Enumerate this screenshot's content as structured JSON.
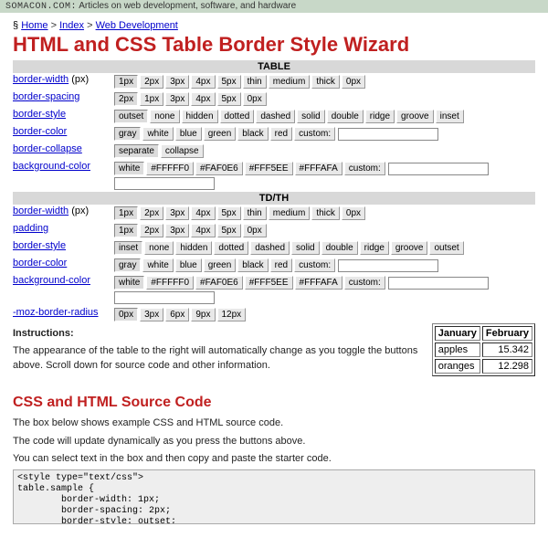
{
  "topbar": {
    "brand": "SOMACON.COM:",
    "tagline": "Articles on web development, software, and hardware"
  },
  "breadcrumb": {
    "prefix": "§",
    "home": "Home",
    "index": "Index",
    "wd": "Web Development",
    "sep": ">"
  },
  "title": "HTML and CSS Table Border Style Wizard",
  "groups": {
    "table": {
      "header": "TABLE",
      "rows": {
        "border_width": {
          "label": "border-width",
          "suffix": "(px)",
          "opts": [
            "1px",
            "2px",
            "3px",
            "4px",
            "5px",
            "thin",
            "medium",
            "thick",
            "0px"
          ],
          "sel": 0
        },
        "border_spacing": {
          "label": "border-spacing",
          "opts": [
            "2px",
            "1px",
            "3px",
            "4px",
            "5px",
            "0px"
          ],
          "sel": 0
        },
        "border_style": {
          "label": "border-style",
          "opts": [
            "outset",
            "none",
            "hidden",
            "dotted",
            "dashed",
            "solid",
            "double",
            "ridge",
            "groove",
            "inset"
          ],
          "sel": 0
        },
        "border_color": {
          "label": "border-color",
          "opts": [
            "gray",
            "white",
            "blue",
            "green",
            "black",
            "red",
            "custom:"
          ],
          "sel": 0,
          "custom": ""
        },
        "border_collapse": {
          "label": "border-collapse",
          "opts": [
            "separate",
            "collapse"
          ],
          "sel": 0
        },
        "background_color": {
          "label": "background-color",
          "opts": [
            "white",
            "#FFFFF0",
            "#FAF0E6",
            "#FFF5EE",
            "#FFFAFA",
            "custom:"
          ],
          "sel": 0,
          "custom": ""
        }
      }
    },
    "tdth": {
      "header": "TD/TH",
      "rows": {
        "border_width": {
          "label": "border-width",
          "suffix": "(px)",
          "opts": [
            "1px",
            "2px",
            "3px",
            "4px",
            "5px",
            "thin",
            "medium",
            "thick",
            "0px"
          ],
          "sel": 0
        },
        "padding": {
          "label": "padding",
          "opts": [
            "1px",
            "2px",
            "3px",
            "4px",
            "5px",
            "0px"
          ],
          "sel": 0
        },
        "border_style": {
          "label": "border-style",
          "opts": [
            "inset",
            "none",
            "hidden",
            "dotted",
            "dashed",
            "solid",
            "double",
            "ridge",
            "groove",
            "outset"
          ],
          "sel": 0
        },
        "border_color": {
          "label": "border-color",
          "opts": [
            "gray",
            "white",
            "blue",
            "green",
            "black",
            "red",
            "custom:"
          ],
          "sel": 0,
          "custom": ""
        },
        "background_color": {
          "label": "background-color",
          "opts": [
            "white",
            "#FFFFF0",
            "#FAF0E6",
            "#FFF5EE",
            "#FFFAFA",
            "custom:"
          ],
          "sel": 0,
          "custom": ""
        },
        "moz_radius": {
          "label": "-moz-border-radius",
          "opts": [
            "0px",
            "3px",
            "6px",
            "9px",
            "12px"
          ],
          "sel": 0
        }
      }
    }
  },
  "instructions": {
    "label": "Instructions:",
    "text": "The appearance of the table to the right will automatically change as you toggle the buttons above. Scroll down for source code and other information."
  },
  "sample_table": {
    "headers": [
      "January",
      "February"
    ],
    "rows": [
      [
        "apples",
        "15.342"
      ],
      [
        "oranges",
        "12.298"
      ]
    ]
  },
  "source_section": {
    "heading": "CSS and HTML Source Code",
    "p1": "The box below shows example CSS and HTML source code.",
    "p2": "The code will update dynamically as you press the buttons above.",
    "p3": "You can select text in the box and then copy and paste the starter code.",
    "code": "<style type=\"text/css\">\ntable.sample {\n        border-width: 1px;\n        border-spacing: 2px;\n        border-style: outset;\n        border-color: gray;\n        border-collapse: separate;"
  }
}
